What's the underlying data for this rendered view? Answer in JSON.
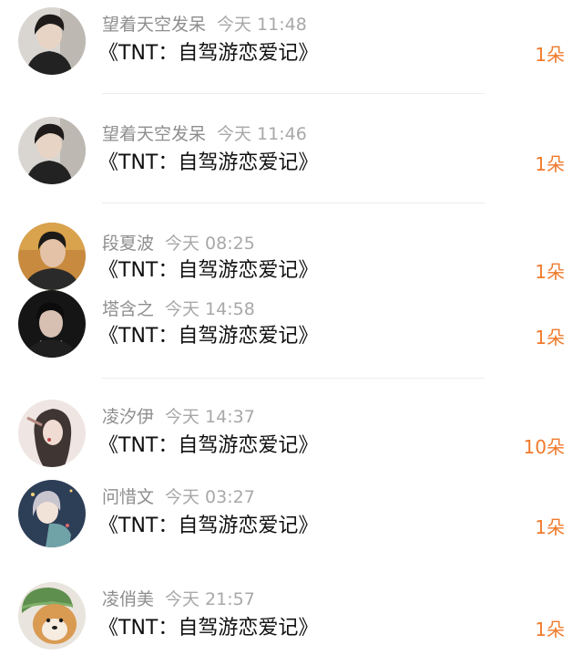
{
  "colors": {
    "name_text": "#8e8e8e",
    "time_text": "#a8a8a8",
    "title_text": "#111111",
    "count_text": "#f07a2c",
    "divider": "#ececec"
  },
  "items": [
    {
      "name": "望着天空发呆",
      "time": "今天 11:48",
      "title": "《TNT：自驾游恋爱记》",
      "count": "1朵",
      "avatar_icon": "dark-hair-man-avatar"
    },
    {
      "name": "望着天空发呆",
      "time": "今天 11:46",
      "title": "《TNT：自驾游恋爱记》",
      "count": "1朵",
      "avatar_icon": "dark-hair-man-avatar"
    },
    {
      "name": "段夏波",
      "time": "今天 08:25",
      "title": "《TNT：自驾游恋爱记》",
      "count": "1朵",
      "avatar_icon": "man-portrait-avatar"
    },
    {
      "name": "塔含之",
      "time": "今天 14:58",
      "title": "《TNT：自驾游恋爱记》",
      "count": "1朵",
      "avatar_icon": "man-portrait-avatar"
    },
    {
      "name": "凌汐伊",
      "time": "今天 14:37",
      "title": "《TNT：自驾游恋爱记》",
      "count": "10朵",
      "avatar_icon": "girl-portrait-avatar"
    },
    {
      "name": "问惜文",
      "time": "今天 03:27",
      "title": "《TNT：自驾游恋爱记》",
      "count": "1朵",
      "avatar_icon": "anime-girl-avatar"
    },
    {
      "name": "凌俏美",
      "time": "今天 21:57",
      "title": "《TNT：自驾游恋爱记》",
      "count": "1朵",
      "avatar_icon": "shiba-dog-avatar"
    }
  ]
}
